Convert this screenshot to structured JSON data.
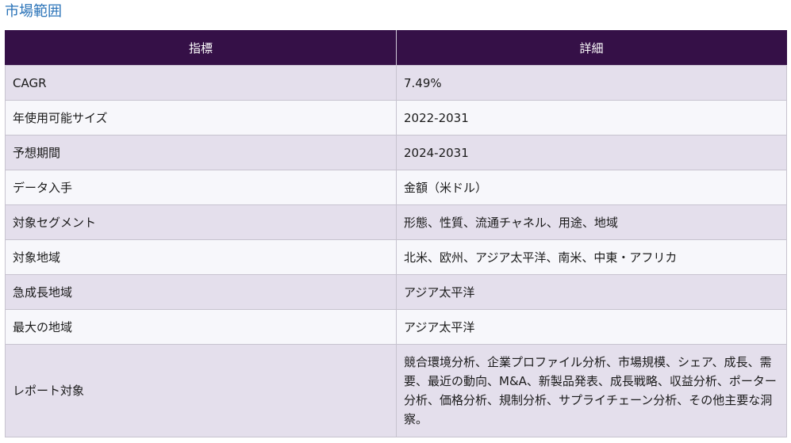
{
  "heading": "市場範囲",
  "table": {
    "headers": [
      "指標",
      "詳細"
    ],
    "rows": [
      {
        "metric": "CAGR",
        "detail": "7.49%"
      },
      {
        "metric": "年使用可能サイズ",
        "detail": "2022-2031"
      },
      {
        "metric": "予想期間",
        "detail": "2024-2031"
      },
      {
        "metric": "データ入手",
        "detail": "金額（米ドル）"
      },
      {
        "metric": "対象セグメント",
        "detail": "形態、性質、流通チャネル、用途、地域"
      },
      {
        "metric": "対象地域",
        "detail": "北米、欧州、アジア太平洋、南米、中東・アフリカ"
      },
      {
        "metric": "急成長地域",
        "detail": "アジア太平洋"
      },
      {
        "metric": "最大の地域",
        "detail": "アジア太平洋"
      },
      {
        "metric": "レポート対象",
        "detail": "競合環境分析、企業プロファイル分析、市場規模、シェア、成長、需要、最近の動向、M&A、新製品発表、成長戦略、収益分析、ポーター分析、価格分析、規制分析、サプライチェーン分析、その他主要な洞察。"
      }
    ]
  }
}
